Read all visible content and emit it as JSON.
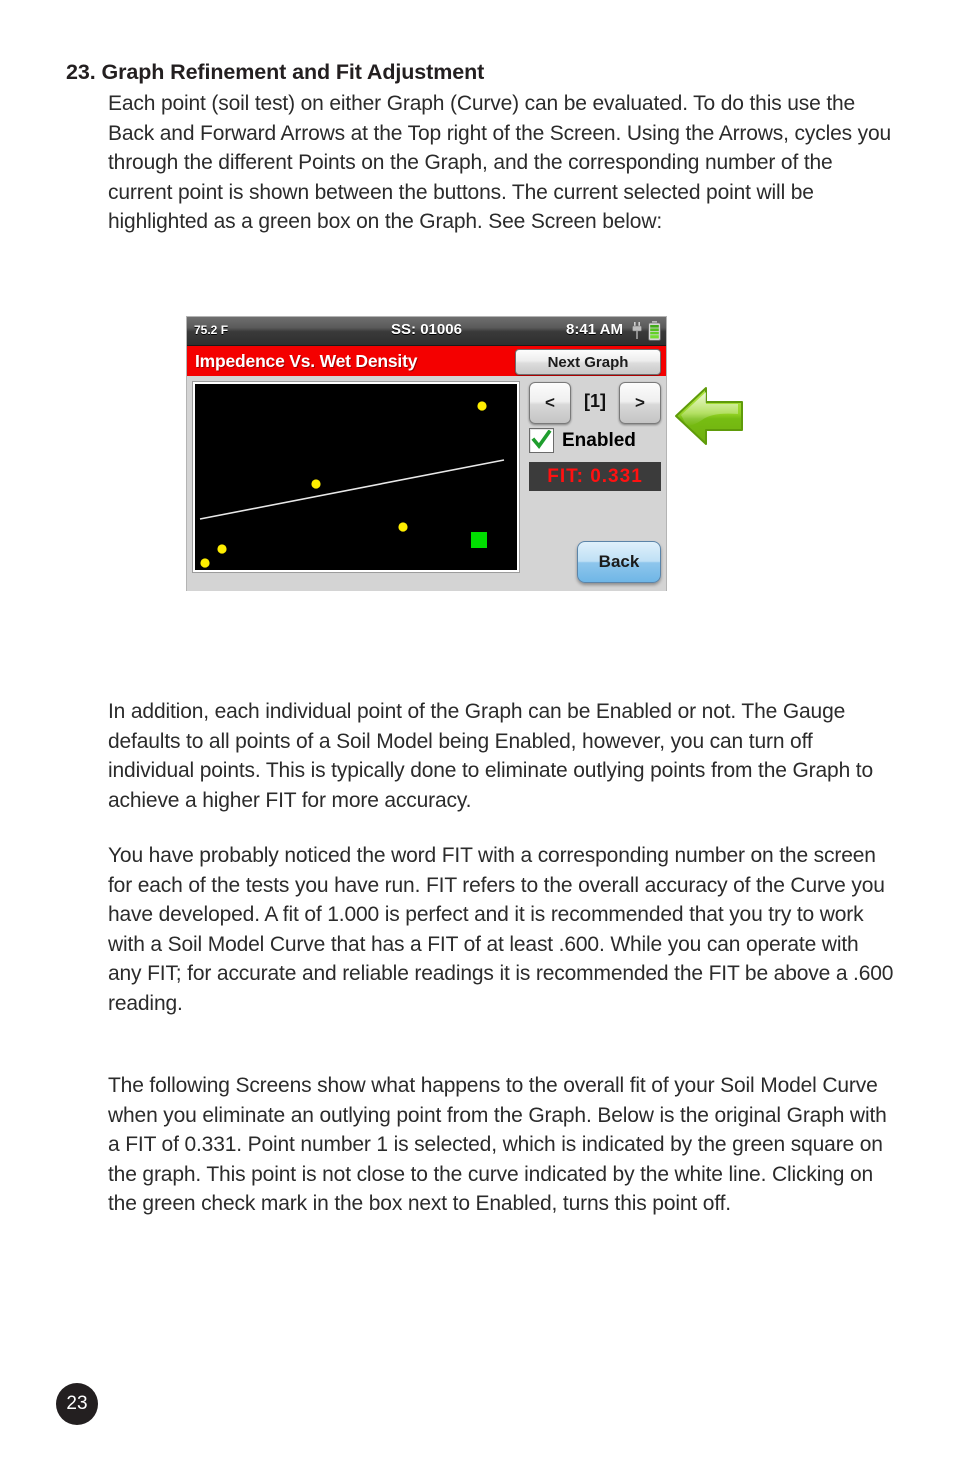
{
  "document": {
    "heading": "23. Graph Refinement and Fit Adjustment",
    "page_number": "23",
    "paragraphs": {
      "intro": "Each point (soil test) on either Graph (Curve) can be evaluated. To do this use the Back and Forward Arrows at the Top right of the Screen. Using the Arrows, cycles you through the different Points on the Graph, and the corresponding number of the current point is shown between the buttons. The current selected point will be highlighted as a green box on the Graph. See Screen below:",
      "enable": "In addition, each individual point of the Graph can be Enabled or not. The Gauge defaults to all points of a Soil Model being Enabled, however, you can turn off individual points. This is typically done to eliminate outlying points from the Graph to achieve a higher FIT for more accuracy.",
      "fit": "You have probably noticed the word FIT with a corresponding number on the screen for each of the tests you have run. FIT refers to the overall accuracy of the Curve you have developed. A fit of 1.000 is perfect and it is recommended that you try to work with a Soil Model Curve that has a FIT of at least .600. While you can operate with any FIT; for accurate and reliable readings it is recommended the FIT be above a .600 reading.",
      "screens": "The following Screens show what happens to the overall fit of your Soil Model Curve when you eliminate an outlying point from the Graph. Below is the original Graph with a FIT of 0.331. Point number 1 is selected, which is indicated by the green square on the graph. This point is not close to the curve indicated by the white line. Clicking on the green check mark in the box next to Enabled, turns this point off."
    }
  },
  "device": {
    "status_bar": {
      "temperature": "75.2 F",
      "serial": "SS: 01006",
      "time": "8:41 AM",
      "plug_icon": "power-plug-icon",
      "battery_icon": "battery-full-icon"
    },
    "title_bar": {
      "title": "Impedence Vs. Wet Density",
      "next_graph_label": "Next Graph"
    },
    "controls": {
      "prev_label": "<",
      "next_label": ">",
      "point_index": "[1]",
      "enabled_label": "Enabled",
      "enabled_checked": true,
      "fit_label": "FIT:  0.331",
      "back_label": "Back"
    },
    "colors": {
      "title_bar_red": "#f40000",
      "fit_text_red": "#ff1111",
      "point_yellow": "#ffee00",
      "selected_green": "#00dd00",
      "curve_white": "#e8e8e8",
      "chrome_grey": "#d4d4d4"
    }
  },
  "chart_data": {
    "type": "scatter",
    "title": "Impedence Vs. Wet Density",
    "xlabel": "",
    "ylabel": "",
    "grid": false,
    "legend": null,
    "axis_ticks": [],
    "xlim": [
      0,
      100
    ],
    "ylim": [
      0,
      100
    ],
    "series": [
      {
        "name": "soil test points",
        "marker": "circle",
        "color": "#ffee00",
        "points": [
          {
            "x": 3.0,
            "y": 4.0
          },
          {
            "x": 8.5,
            "y": 11.5
          },
          {
            "x": 37.5,
            "y": 46.5
          },
          {
            "x": 64.5,
            "y": 23.5
          },
          {
            "x": 89.0,
            "y": 88.5
          }
        ]
      },
      {
        "name": "selected point",
        "marker": "square",
        "color": "#00dd00",
        "points": [
          {
            "x": 87.5,
            "y": 17.5
          }
        ]
      }
    ],
    "fit_line": {
      "name": "best fit curve",
      "color": "#e8e8e8",
      "x": [
        1.5,
        96.0
      ],
      "y": [
        27.5,
        59.0
      ],
      "fit_value": 0.331
    }
  },
  "annotation": {
    "arrow_icon": "left-arrow-callout-icon",
    "arrow_color": "#8fd01a"
  }
}
